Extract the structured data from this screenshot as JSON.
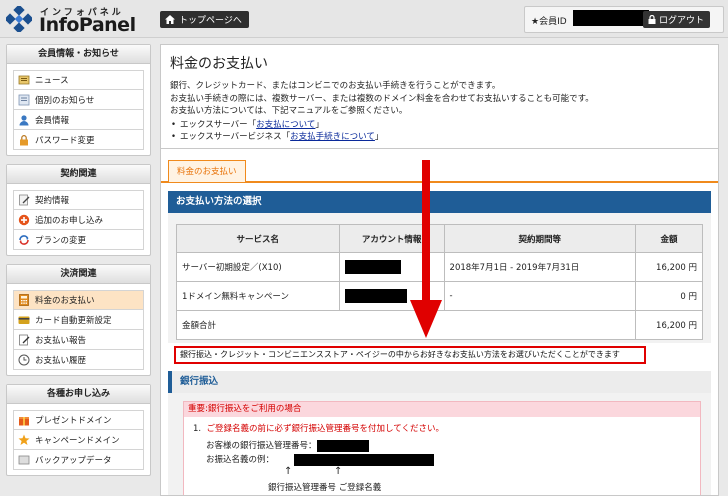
{
  "header": {
    "logo_sub": "インフォパネル",
    "logo_main": "InfoPanel",
    "top_button": "トップページへ",
    "member_label": "★会員ID",
    "logout": "ログアウト"
  },
  "sidebar": {
    "sections": [
      {
        "title": "会員情報・お知らせ",
        "items": [
          {
            "label": "ニュース",
            "icon": "news-icon"
          },
          {
            "label": "個別のお知らせ",
            "icon": "notice-icon"
          },
          {
            "label": "会員情報",
            "icon": "user-icon"
          },
          {
            "label": "パスワード変更",
            "icon": "lock-icon"
          }
        ]
      },
      {
        "title": "契約関連",
        "items": [
          {
            "label": "契約情報",
            "icon": "contract-icon"
          },
          {
            "label": "追加のお申し込み",
            "icon": "plus-icon"
          },
          {
            "label": "プランの変更",
            "icon": "refresh-icon"
          }
        ]
      },
      {
        "title": "決済関連",
        "items": [
          {
            "label": "料金のお支払い",
            "icon": "calculator-icon",
            "active": true
          },
          {
            "label": "カード自動更新設定",
            "icon": "card-icon"
          },
          {
            "label": "お支払い報告",
            "icon": "report-icon"
          },
          {
            "label": "お支払い履歴",
            "icon": "clock-icon"
          }
        ]
      },
      {
        "title": "各種お申し込み",
        "items": [
          {
            "label": "プレゼントドメイン",
            "icon": "gift-icon"
          },
          {
            "label": "キャンペーンドメイン",
            "icon": "star-icon"
          },
          {
            "label": "バックアップデータ",
            "icon": "backup-icon"
          }
        ]
      }
    ]
  },
  "main": {
    "title": "料金のお支払い",
    "intro": [
      "銀行、クレジットカード、またはコンビニでのお支払い手続きを行うことができます。",
      "お支払い手続きの際には、複数サーバー、または複数のドメイン料金を合わせてお支払いすることも可能です。",
      "お支払い方法については、下記マニュアルをご参照ください。"
    ],
    "links": [
      {
        "prefix": "エックスサーバー「",
        "text": "お支払について",
        "suffix": "」"
      },
      {
        "prefix": "エックスサーバービジネス「",
        "text": "お支払手続きについて",
        "suffix": "」"
      }
    ],
    "tab": "料金のお支払い",
    "section_title": "お支払い方法の選択",
    "table": {
      "headers": [
        "サービス名",
        "アカウント情報",
        "契約期間等",
        "金額"
      ],
      "rows": [
        {
          "service": "サーバー初期設定／(X10)",
          "period": "2018年7月1日 - 2019年7月31日",
          "amount": "16,200 円"
        },
        {
          "service": "1ドメイン無料キャンペーン",
          "period": "-",
          "amount": "0 円"
        }
      ],
      "total_label": "金額合計",
      "total": "16,200 円"
    },
    "notice": "銀行振込・クレジット・コンビニエンスストア・ペイジーの中からお好きなお支払い方法をお選びいただくことができます",
    "bank": {
      "title": "銀行振込",
      "warn_title": "重要:銀行振込をご利用の場合",
      "warn_num": "1.",
      "warn_line": "ご登録名義の前に必ず銀行振込管理番号を付加してください。",
      "mgmt_label": "お客様の銀行振込管理番号：",
      "example_label": "お振込名義の例：",
      "caption": "銀行振込管理番号 ご登録名義"
    }
  },
  "colors": {
    "accent": "#f08a1c",
    "header_blue": "#1f5d97",
    "alert_red": "#e00000"
  }
}
